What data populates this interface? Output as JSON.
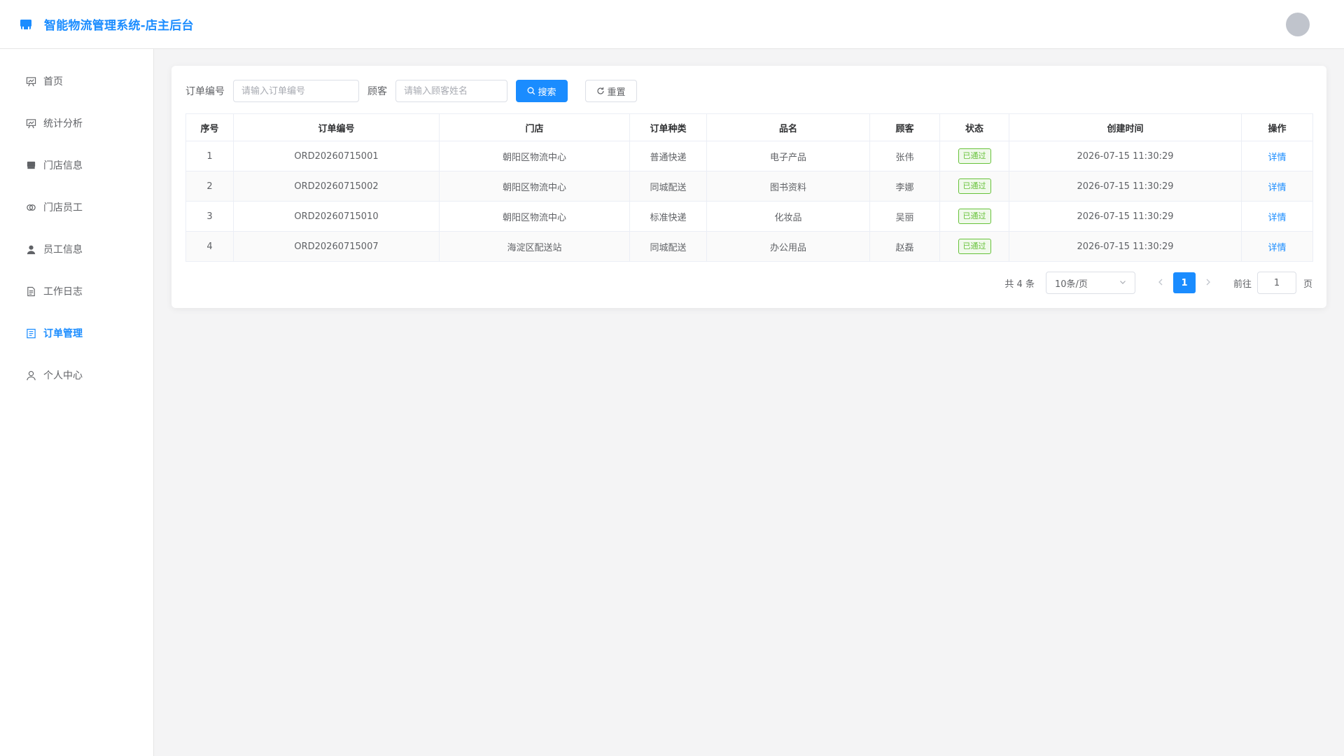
{
  "header": {
    "app_title": "智能物流管理系统-店主后台",
    "logo_icon": "store-icon",
    "avatar": "user-avatar"
  },
  "sidebar": {
    "items": [
      {
        "label": "首页",
        "icon": "presentation-icon",
        "active": false
      },
      {
        "label": "统计分析",
        "icon": "presentation-icon",
        "active": false
      },
      {
        "label": "门店信息",
        "icon": "store-icon",
        "active": false
      },
      {
        "label": "门店员工",
        "icon": "link-icon",
        "active": false
      },
      {
        "label": "员工信息",
        "icon": "user-filled-icon",
        "active": false
      },
      {
        "label": "工作日志",
        "icon": "document-icon",
        "active": false
      },
      {
        "label": "订单管理",
        "icon": "list-icon",
        "active": true
      },
      {
        "label": "个人中心",
        "icon": "user-icon",
        "active": false
      }
    ]
  },
  "filter": {
    "order_label": "订单编号",
    "order_placeholder": "请输入订单编号",
    "order_value": "",
    "customer_label": "顾客",
    "customer_placeholder": "请输入顾客姓名",
    "customer_value": "",
    "search_label": "搜索",
    "reset_label": "重置"
  },
  "table": {
    "columns": [
      "序号",
      "订单编号",
      "门店",
      "订单种类",
      "品名",
      "顾客",
      "状态",
      "创建时间",
      "操作"
    ],
    "rows": [
      {
        "index": "1",
        "order_no": "ORD20260715001",
        "store": "朝阳区物流中心",
        "type": "普通快递",
        "product": "电子产品",
        "customer": "张伟",
        "status": "已通过",
        "created": "2026-07-15 11:30:29",
        "action": "详情"
      },
      {
        "index": "2",
        "order_no": "ORD20260715002",
        "store": "朝阳区物流中心",
        "type": "同城配送",
        "product": "图书资料",
        "customer": "李娜",
        "status": "已通过",
        "created": "2026-07-15 11:30:29",
        "action": "详情"
      },
      {
        "index": "3",
        "order_no": "ORD20260715010",
        "store": "朝阳区物流中心",
        "type": "标准快递",
        "product": "化妆品",
        "customer": "吴丽",
        "status": "已通过",
        "created": "2026-07-15 11:30:29",
        "action": "详情"
      },
      {
        "index": "4",
        "order_no": "ORD20260715007",
        "store": "海淀区配送站",
        "type": "同城配送",
        "product": "办公用品",
        "customer": "赵磊",
        "status": "已通过",
        "created": "2026-07-15 11:30:29",
        "action": "详情"
      }
    ]
  },
  "pagination": {
    "total": "共 4 条",
    "page_size": "10条/页",
    "current_page": "1",
    "jump_label": "前往",
    "jump_value": "1",
    "jump_suffix": "页"
  },
  "colors": {
    "primary": "#1a8cff",
    "success": "#67c23a",
    "background": "#f4f4f5"
  }
}
